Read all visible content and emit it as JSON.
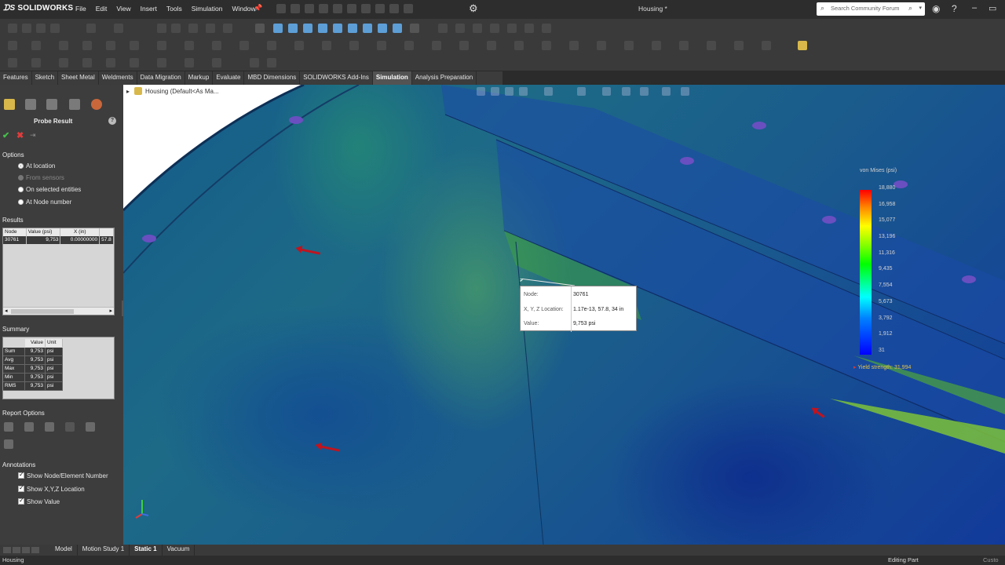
{
  "app": {
    "brand": "SOLIDWORKS",
    "menu": [
      "File",
      "Edit",
      "View",
      "Insert",
      "Tools",
      "Simulation",
      "Window"
    ],
    "document_title": "Housing *",
    "search_placeholder": "Search Community Forum"
  },
  "command_tabs": [
    "Features",
    "Sketch",
    "Sheet Metal",
    "Weldments",
    "Data Migration",
    "Markup",
    "Evaluate",
    "MBD Dimensions",
    "SOLIDWORKS Add-Ins",
    "Simulation",
    "Analysis Preparation"
  ],
  "active_command_tab": "Simulation",
  "probe_panel": {
    "title": "Probe Result",
    "options_heading": "Options",
    "options": [
      {
        "label": "At location",
        "selected": true,
        "enabled": true
      },
      {
        "label": "From sensors",
        "selected": false,
        "enabled": false
      },
      {
        "label": "On selected entities",
        "selected": false,
        "enabled": true
      },
      {
        "label": "At Node number",
        "selected": false,
        "enabled": true
      }
    ],
    "results_heading": "Results",
    "results_columns": [
      "Node",
      "Value (psi)",
      "X (in)"
    ],
    "results_rows": [
      {
        "node": "30761",
        "value": "9,753",
        "x": "0.00000000",
        "y": "57.8"
      }
    ],
    "summary_heading": "Summary",
    "summary_columns": [
      "Value",
      "Unit"
    ],
    "summary_rows": [
      {
        "label": "Sum",
        "value": "9,753",
        "unit": "psi"
      },
      {
        "label": "Avg",
        "value": "9,753",
        "unit": "psi"
      },
      {
        "label": "Max",
        "value": "9,753",
        "unit": "psi"
      },
      {
        "label": "Min",
        "value": "9,753",
        "unit": "psi"
      },
      {
        "label": "RMS",
        "value": "9,753",
        "unit": "psi"
      }
    ],
    "report_options_heading": "Report Options",
    "annotations_heading": "Annotations",
    "annotations": [
      "Show Node/Element Number",
      "Show X,Y,Z Location",
      "Show Value"
    ]
  },
  "tree": {
    "label": "Housing  (Default<As Ma..."
  },
  "legend": {
    "title": "von Mises (psi)",
    "values": [
      "18,880",
      "16,958",
      "15,077",
      "13,196",
      "11,316",
      "9,435",
      "7,554",
      "5,673",
      "3,792",
      "1,912",
      "31"
    ],
    "yield": "Yield strength: 31,994"
  },
  "callout": {
    "node_label": "Node:",
    "node_value": "30761",
    "location_label": "X, Y, Z Location:",
    "location_value": "1.17e-13, 57.8, 34 in",
    "value_label": "Value:",
    "value_value": "9,753 psi"
  },
  "bottom_tabs": [
    "Model",
    "Motion Study 1",
    "Static 1",
    "Vacuum"
  ],
  "active_bottom_tab": "Static 1",
  "status": {
    "left": "Housing",
    "right": "Editing Part",
    "far_right": "Custo"
  },
  "colors": {
    "accent_green": "#45c04a",
    "cancel_red": "#e03c3c",
    "load_arrow": "#c0141f",
    "yield_text": "#e6c64a"
  }
}
